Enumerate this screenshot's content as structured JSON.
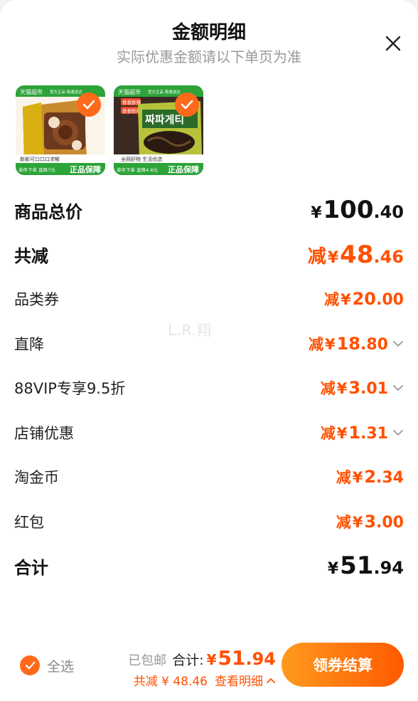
{
  "header": {
    "title": "金额明细",
    "subtitle": "实际优惠金额请以下单页为准"
  },
  "products": [
    {
      "name": "chocolate-snack",
      "banner": "天猫超市",
      "banner_note": "官方正品 极速送达",
      "bottom_line": "新款可口口口浓郁",
      "price_note": "单件下单 直降7元",
      "guarantee": "正品保障",
      "selected": true
    },
    {
      "name": "ramen-noodles",
      "banner": "天猫超市",
      "banner_note": "官方正品 极速送达",
      "tag1": "香香鲜辣",
      "tag2": "香香鲜辣",
      "brand_text": "짜파게티",
      "bottom_line": "全网好物 生活优选",
      "price_note": "单件下单 直降4.8元",
      "guarantee": "正品保障",
      "selected": true
    }
  ],
  "rows": {
    "goods_total": {
      "label": "商品总价",
      "yen": "¥",
      "int": "100",
      "dec": ".40"
    },
    "total_discount": {
      "label": "共减",
      "prefix": "减",
      "yen": "¥",
      "int": "48",
      "dec": ".46"
    },
    "category_coupon": {
      "label": "品类券",
      "prefix": "减",
      "yen": "¥",
      "int": "20",
      "dec": ".00"
    },
    "direct_cut": {
      "label": "直降",
      "prefix": "减",
      "yen": "¥",
      "int": "18",
      "dec": ".80"
    },
    "vip": {
      "label": "88VIP专享9.5折",
      "prefix": "减",
      "yen": "¥",
      "int": "3",
      "dec": ".01"
    },
    "store": {
      "label": "店铺优惠",
      "prefix": "减",
      "yen": "¥",
      "int": "1",
      "dec": ".31"
    },
    "gold_coin": {
      "label": "淘金币",
      "prefix": "减",
      "yen": "¥",
      "int": "2",
      "dec": ".34"
    },
    "red_packet": {
      "label": "红包",
      "prefix": "减",
      "yen": "¥",
      "int": "3",
      "dec": ".00"
    },
    "sum": {
      "label": "合计",
      "yen": "¥",
      "int": "51",
      "dec": ".94"
    }
  },
  "watermark": "L.R.翔",
  "footer": {
    "select_all": "全选",
    "shipping": "已包邮",
    "total_label": "合计:",
    "total_yen": "¥",
    "total_int": "51",
    "total_dec": ".94",
    "saved": "共减 ¥ 48.46",
    "detail_link": "查看明细",
    "checkout": "领券结算"
  },
  "colors": {
    "accent": "#ff5000",
    "accent_gradient_start": "#ff9a1e",
    "accent_gradient_end": "#ff5a00",
    "tmall_green": "#2da339"
  }
}
